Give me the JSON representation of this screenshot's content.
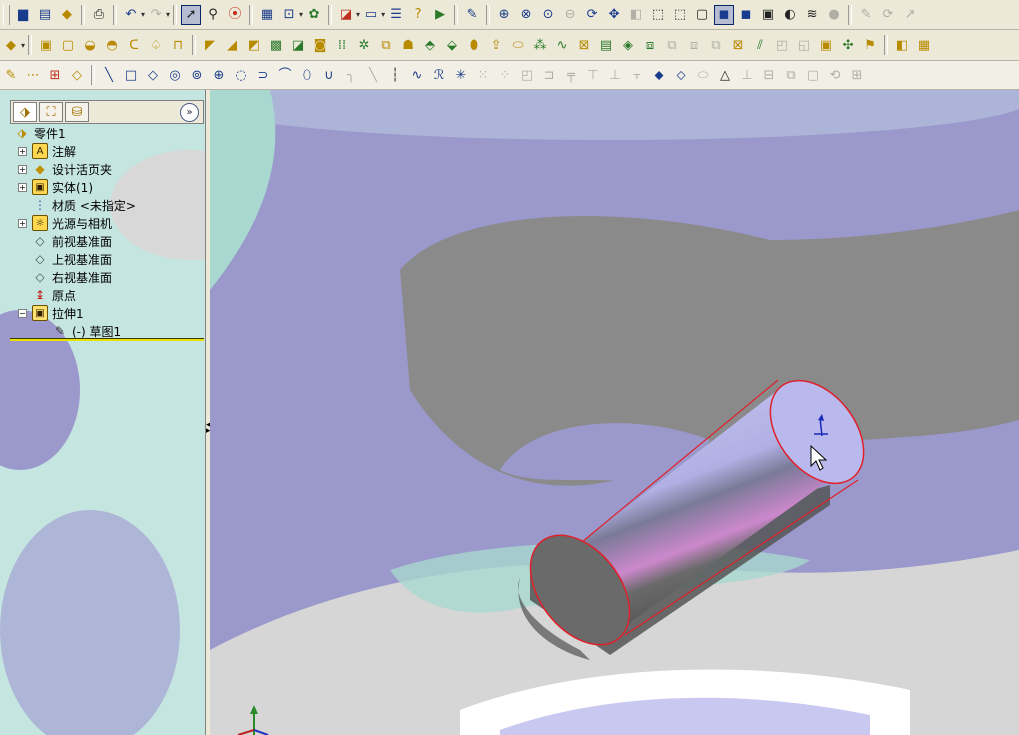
{
  "colors": {
    "viewport_bg": "#9b98cc",
    "panel_bg": "#c5e5e0",
    "toolbar_bg": "#ece9d8",
    "cylinder_edge": "#e0202a",
    "separator_line": "#e8e000"
  },
  "toolbars": {
    "standard": [
      "save-icon",
      "save-as-icon",
      "part-icon",
      "print-icon",
      "undo-icon",
      "redo-icon",
      "select-arrow-icon",
      "select-filter-icon",
      "traffic-light-icon",
      "options-grid-icon",
      "view-orient-icon",
      "appearance-icon",
      "3d-box-icon",
      "window-icon",
      "list-icon",
      "help-icon",
      "run-macro-icon",
      "sketch-pencil-icon",
      "zoom-fit-icon",
      "zoom-area-icon",
      "zoom-in-out-icon",
      "zoom-prev-icon",
      "rotate-icon",
      "pan-icon",
      "section-view-icon",
      "wireframe-icon",
      "hidden-lines-icon",
      "hidden-removed-icon",
      "shaded-icon",
      "shaded-edges-icon",
      "perspective-icon",
      "shadows-icon",
      "zebra-icon",
      "realview-icon"
    ],
    "features": [
      "extrude-icon",
      "revolve-icon",
      "sweep-icon",
      "loft-icon",
      "fillet-icon",
      "chamfer-icon",
      "rib-icon",
      "shell-icon",
      "draft-icon",
      "hole-icon",
      "pattern-icon",
      "mirror-icon",
      "dome-icon",
      "scale-icon",
      "reference-plane-icon",
      "curve-icon"
    ],
    "sketch": [
      "sketch-icon",
      "grid-icon",
      "smart-dim-icon",
      "line-icon",
      "rectangle-icon",
      "polygon-icon",
      "circle-icon",
      "arc-icon",
      "spline-icon",
      "ellipse-icon",
      "point-icon",
      "centerline-icon",
      "text-icon",
      "trim-icon",
      "offset-icon",
      "mirror-entities-icon"
    ]
  },
  "feature_manager": {
    "tabs": [
      "feature-manager-tab",
      "property-manager-tab",
      "configuration-manager-tab"
    ],
    "collapse_label": "»",
    "items": [
      {
        "label": "零件1",
        "icon": "part-icon",
        "level": 0,
        "expander": ""
      },
      {
        "label": "注解",
        "icon": "annotations-icon",
        "level": 1,
        "expander": "+"
      },
      {
        "label": "设计活页夹",
        "icon": "design-binder-icon",
        "level": 1,
        "expander": "+"
      },
      {
        "label": "实体(1)",
        "icon": "solid-bodies-icon",
        "level": 1,
        "expander": "+"
      },
      {
        "label": "材质 <未指定>",
        "icon": "material-icon",
        "level": 1,
        "expander": ""
      },
      {
        "label": "光源与相机",
        "icon": "lights-cameras-icon",
        "level": 1,
        "expander": "+"
      },
      {
        "label": "前视基准面",
        "icon": "plane-icon",
        "level": 1,
        "expander": ""
      },
      {
        "label": "上视基准面",
        "icon": "plane-icon",
        "level": 1,
        "expander": ""
      },
      {
        "label": "右视基准面",
        "icon": "plane-icon",
        "level": 1,
        "expander": ""
      },
      {
        "label": "原点",
        "icon": "origin-icon",
        "level": 1,
        "expander": ""
      },
      {
        "label": "拉伸1",
        "icon": "extrude-feature-icon",
        "level": 1,
        "expander": "−"
      },
      {
        "label": "(-) 草图1",
        "icon": "sketch-icon",
        "level": 2,
        "expander": ""
      }
    ]
  }
}
